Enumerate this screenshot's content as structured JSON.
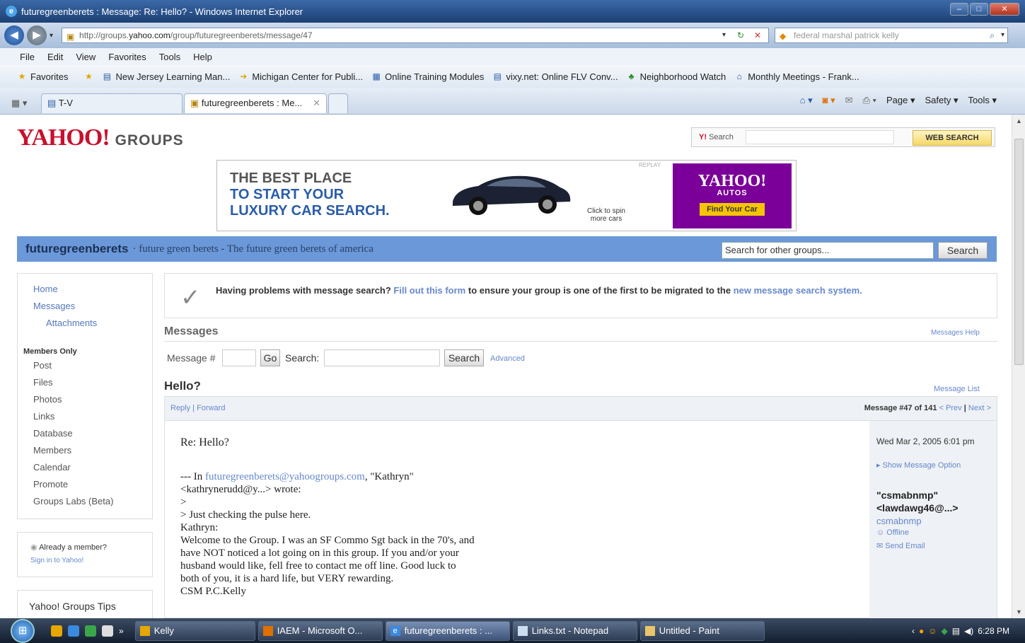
{
  "window": {
    "title": "futuregreenberets : Message: Re: Hello? - Windows Internet Explorer"
  },
  "address": {
    "prefix": "http://groups.",
    "domain": "yahoo.com",
    "suffix": "/group/futuregreenberets/message/47",
    "search_value": "federal marshal patrick kelly"
  },
  "menu": [
    "File",
    "Edit",
    "View",
    "Favorites",
    "Tools",
    "Help"
  ],
  "favorites": {
    "label": "Favorites",
    "items": [
      "New Jersey Learning Man...",
      "Michigan Center for Publi...",
      "Online Training Modules",
      "vixy.net: Online FLV Conv...",
      "Neighborhood Watch",
      "Monthly Meetings - Frank..."
    ]
  },
  "tabs": {
    "group": "T-V",
    "active": "futuregreenberets : Me..."
  },
  "commands": {
    "page": "Page ▾",
    "safety": "Safety ▾",
    "tools": "Tools ▾"
  },
  "yahoo": {
    "logo": "YAHOO!",
    "groups": "GROUPS",
    "search_label": "Search",
    "web_search": "WEB SEARCH"
  },
  "ad": {
    "line1": "THE BEST PLACE",
    "line2": "TO START YOUR",
    "line3": "LUXURY CAR SEARCH.",
    "spin": "Click to spin more cars",
    "tag": "REPLAY",
    "brand": "YAHOO!",
    "brand_sub": "AUTOS",
    "cta": "Find Your Car"
  },
  "group": {
    "name": "futuregreenberets",
    "description": "· future green berets - The future green berets of america",
    "search_placeholder": "Search for other groups...",
    "search_button": "Search"
  },
  "sidebar": {
    "home": "Home",
    "messages": "Messages",
    "attachments": "Attachments",
    "members_only": "Members Only",
    "items": [
      "Post",
      "Files",
      "Photos",
      "Links",
      "Database",
      "Members",
      "Calendar",
      "Promote",
      "Groups Labs (Beta)"
    ],
    "already_member": "Already a member?",
    "sign_in": "Sign in to Yahoo!",
    "tips": "Yahoo! Groups Tips"
  },
  "notice": {
    "pre": "Having problems with message search? ",
    "link1": "Fill out this form",
    "mid": " to ensure your group is one of the first to be migrated to the ",
    "link2": "new message search system."
  },
  "messages": {
    "header": "Messages",
    "help": "Messages Help",
    "msg_num_label": "Message #",
    "go": "Go",
    "search_label": "Search:",
    "search_button": "Search",
    "advanced": "Advanced",
    "subject": "Hello?",
    "message_list": "Message List",
    "reply": "Reply",
    "forward": "Forward",
    "position": "Message #47 of 141",
    "prev": "< Prev",
    "next": "Next >"
  },
  "message": {
    "title": "Re: Hello?",
    "quote_intro": "--- In ",
    "quote_email": "futuregreenberets@yahoogroups.com",
    "quote_name": ", \"Kathryn\"",
    "quote_line2": "<kathrynerudd@y...> wrote:",
    "quote_line3": ">",
    "quote_line4": "> Just checking the pulse here.",
    "quote_line5": "Kathryn:",
    "body": "Welcome to the Group. I was an SF Commo Sgt back in the 70's, and\nhave NOT noticed a lot going on in this group. If you and/or your\nhusband would like, fell free to contact me off line. Good luck to\nboth of you, it is a hard life, but VERY rewarding.\nCSM P.C.Kelly",
    "date": "Wed Mar 2, 2005 6:01 pm",
    "show_options": "Show Message Option",
    "from_name": "\"csmabnmp\"",
    "from_email": "<lawdawg46@...>",
    "alias": "csmabnmp",
    "status": "Offline",
    "send_email": "Send Email"
  },
  "taskbar": {
    "items": [
      "Kelly",
      "IAEM - Microsoft O...",
      "futuregreenberets : ...",
      "Links.txt - Notepad",
      "Untitled - Paint"
    ],
    "time": "6:28 PM"
  }
}
